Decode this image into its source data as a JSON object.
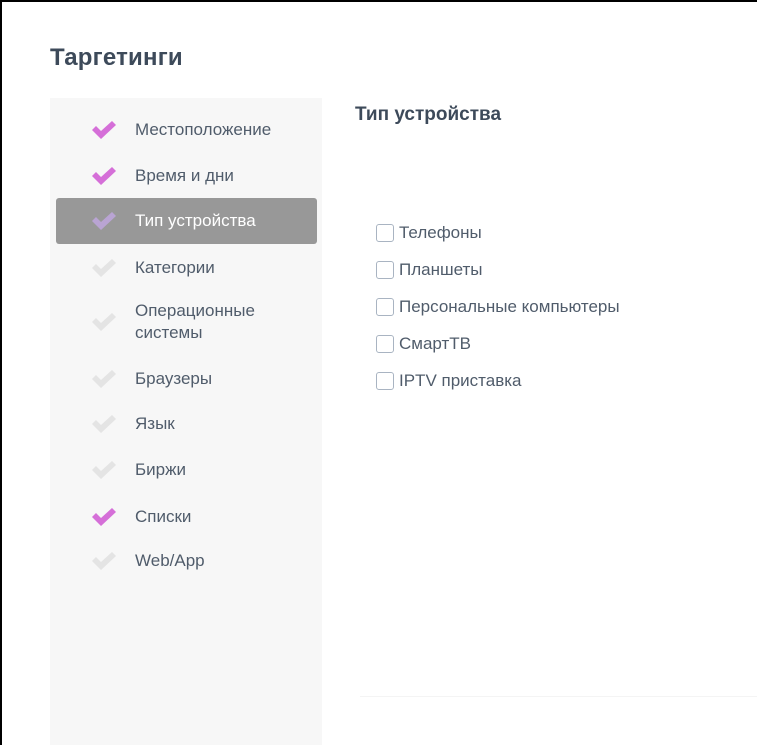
{
  "header": {
    "title": "Таргетинги"
  },
  "sidebar": {
    "items": [
      {
        "label": "Местоположение",
        "checked": true,
        "active": false
      },
      {
        "label": "Время и дни",
        "checked": true,
        "active": false
      },
      {
        "label": "Тип устройства",
        "checked": false,
        "active": true
      },
      {
        "label": "Категории",
        "checked": false,
        "active": false
      },
      {
        "label": "Операционные системы",
        "checked": false,
        "active": false
      },
      {
        "label": "Браузеры",
        "checked": false,
        "active": false
      },
      {
        "label": "Язык",
        "checked": false,
        "active": false
      },
      {
        "label": "Биржи",
        "checked": false,
        "active": false
      },
      {
        "label": "Списки",
        "checked": true,
        "active": false
      },
      {
        "label": "Web/App",
        "checked": false,
        "active": false
      }
    ]
  },
  "main": {
    "section_title": "Тип устройства",
    "options": [
      {
        "label": "Телефоны",
        "checked": false
      },
      {
        "label": "Планшеты",
        "checked": false
      },
      {
        "label": "Персональные компьютеры",
        "checked": false
      },
      {
        "label": "СмартТВ",
        "checked": false
      },
      {
        "label": "IPTV приставка",
        "checked": false
      }
    ]
  },
  "colors": {
    "check_on": "#d56fd8",
    "check_off": "#e4e4e4",
    "active_bg": "#989898",
    "sidebar_bg": "#f7f7f7",
    "text": "#505c6b",
    "heading": "#3d4a5a"
  },
  "icons": {
    "nav_check": "checkmark-icon"
  }
}
